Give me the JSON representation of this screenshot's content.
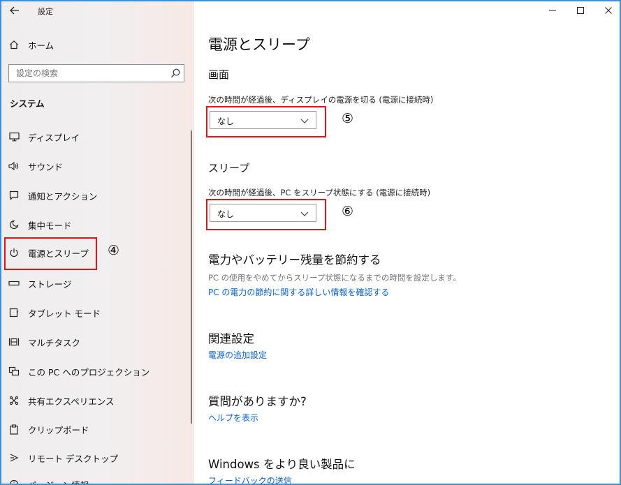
{
  "window": {
    "title": "設定",
    "controls": {
      "minimize_icon": "minimize-icon",
      "maximize_icon": "maximize-icon",
      "close_icon": "close-icon"
    }
  },
  "sidebar": {
    "home_label": "ホーム",
    "search_placeholder": "設定の検索",
    "section_title": "システム",
    "items": [
      {
        "label": "ディスプレイ",
        "icon": "display-icon"
      },
      {
        "label": "サウンド",
        "icon": "sound-icon"
      },
      {
        "label": "通知とアクション",
        "icon": "notification-icon"
      },
      {
        "label": "集中モード",
        "icon": "moon-icon"
      },
      {
        "label": "電源とスリープ",
        "icon": "power-icon",
        "selected": true
      },
      {
        "label": "ストレージ",
        "icon": "storage-icon"
      },
      {
        "label": "タブレット モード",
        "icon": "tablet-icon"
      },
      {
        "label": "マルチタスク",
        "icon": "multitask-icon"
      },
      {
        "label": "この PC へのプロジェクション",
        "icon": "projection-icon"
      },
      {
        "label": "共有エクスペリエンス",
        "icon": "share-icon"
      },
      {
        "label": "クリップボード",
        "icon": "clipboard-icon"
      },
      {
        "label": "リモート デスクトップ",
        "icon": "remote-icon"
      },
      {
        "label": "バージョン情報",
        "icon": "info-icon"
      }
    ]
  },
  "annotations": {
    "sidebar_marker": "④",
    "screen_marker": "⑤",
    "sleep_marker": "⑥",
    "highlight_color": "#e5141a"
  },
  "main": {
    "page_title": "電源とスリープ",
    "screen": {
      "heading": "画面",
      "label": "次の時間が経過後、ディスプレイの電源を切る (電源に接続時)",
      "value": "なし"
    },
    "sleep": {
      "heading": "スリープ",
      "label": "次の時間が経過後、PC をスリープ状態にする (電源に接続時)",
      "value": "なし"
    },
    "battery": {
      "heading": "電力やバッテリー残量を節約する",
      "description": "PC の使用をやめてからスリープ状態になるまでの時間を設定します。",
      "link": "PC の電力の節約に関する詳しい情報を確認する"
    },
    "related": {
      "heading": "関連設定",
      "link": "電源の追加設定"
    },
    "question": {
      "heading": "質問がありますか?",
      "link": "ヘルプを表示"
    },
    "improve": {
      "heading": "Windows をより良い製品に",
      "link": "フィードバックの送信"
    }
  },
  "colors": {
    "accent_link": "#0a62c9",
    "frame_border": "#3d8fd6"
  }
}
